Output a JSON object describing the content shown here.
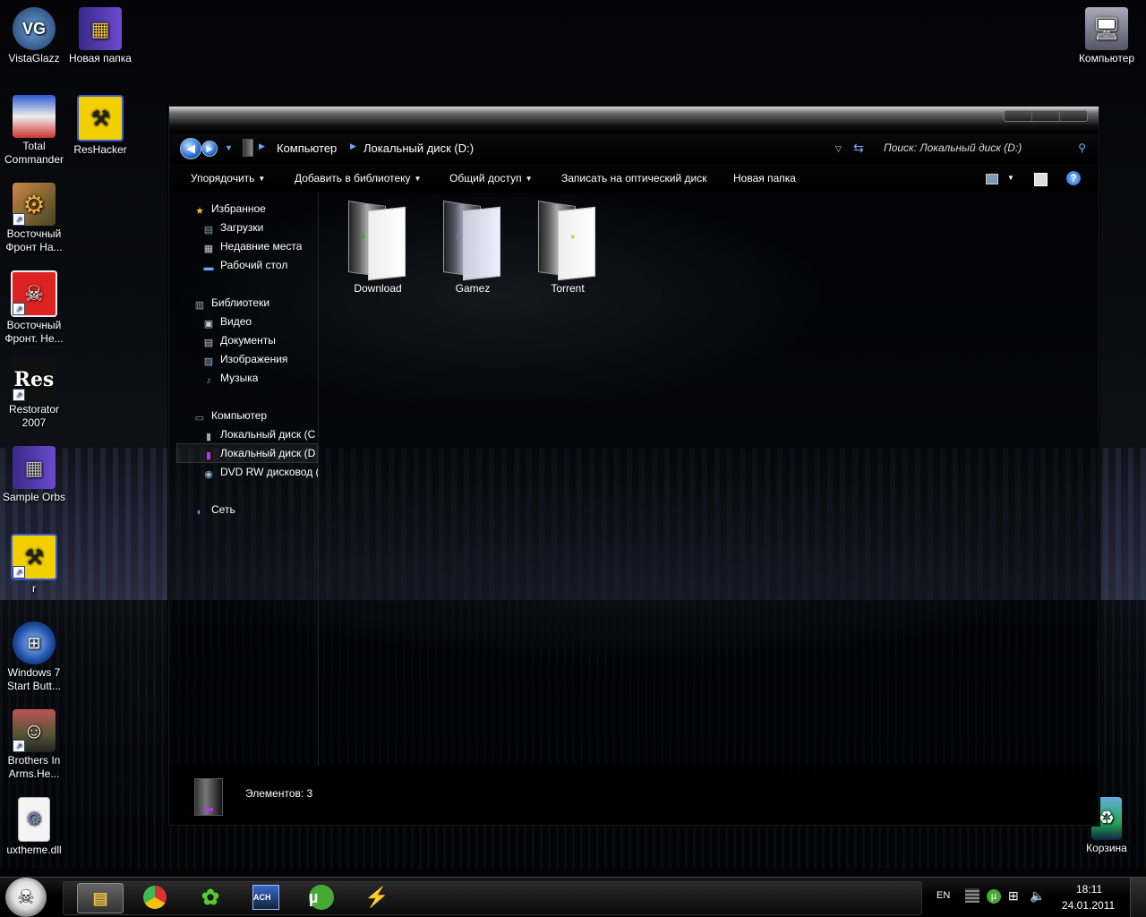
{
  "desktop": {
    "icons": [
      {
        "id": "vistaglazz",
        "label": "VistaGlazz",
        "glyph": "VG"
      },
      {
        "id": "new-folder",
        "label": "Новая папка"
      },
      {
        "id": "total-commander",
        "label": "Total Commander"
      },
      {
        "id": "reshacker",
        "label": "ResHacker"
      },
      {
        "id": "vostochny-front-ha",
        "label": "Восточный Фронт Ha..."
      },
      {
        "id": "vostochny-front-ne",
        "label": "Восточный Фронт. Не..."
      },
      {
        "id": "restorator",
        "label": "Restorator 2007",
        "glyph": "Res"
      },
      {
        "id": "sample-orbs",
        "label": "Sample Orbs"
      },
      {
        "id": "r",
        "label": "r"
      },
      {
        "id": "win7-start",
        "label": "Windows 7 Start Butt..."
      },
      {
        "id": "brothers-in-arms",
        "label": "Brothers In Arms.He..."
      },
      {
        "id": "uxtheme",
        "label": "uxtheme.dll"
      },
      {
        "id": "computer",
        "label": "Компьютер"
      },
      {
        "id": "recycle-bin",
        "label": "Корзина"
      }
    ]
  },
  "explorer": {
    "breadcrumb": [
      "Компьютер",
      "Локальный диск (D:)"
    ],
    "search_placeholder": "Поиск: Локальный диск (D:)",
    "toolbar": {
      "organize": "Упорядочить",
      "add_to_library": "Добавить в библиотеку",
      "share": "Общий доступ",
      "burn": "Записать на оптический диск",
      "new_folder": "Новая папка"
    },
    "nav": {
      "favorites": "Избранное",
      "downloads": "Загрузки",
      "recent": "Недавние места",
      "desktop": "Рабочий стол",
      "libraries": "Библиотеки",
      "video": "Видео",
      "documents": "Документы",
      "pictures": "Изображения",
      "music": "Музыка",
      "computer": "Компьютер",
      "disk_c": "Локальный диск (C",
      "disk_d": "Локальный диск (D",
      "dvd": "DVD RW дисковод (",
      "network": "Сеть"
    },
    "folders": [
      "Download",
      "Gamez",
      "Torrent"
    ],
    "status": "Элементов: 3"
  },
  "taskbar": {
    "language": "EN",
    "time": "18:11",
    "date": "24.01.2011",
    "pins": [
      "explorer",
      "chrome",
      "icq",
      "ach",
      "utorrent",
      "winamp"
    ]
  },
  "colors": {
    "accent_blue": "#2a6fd6",
    "purple": "#b33bd8"
  }
}
